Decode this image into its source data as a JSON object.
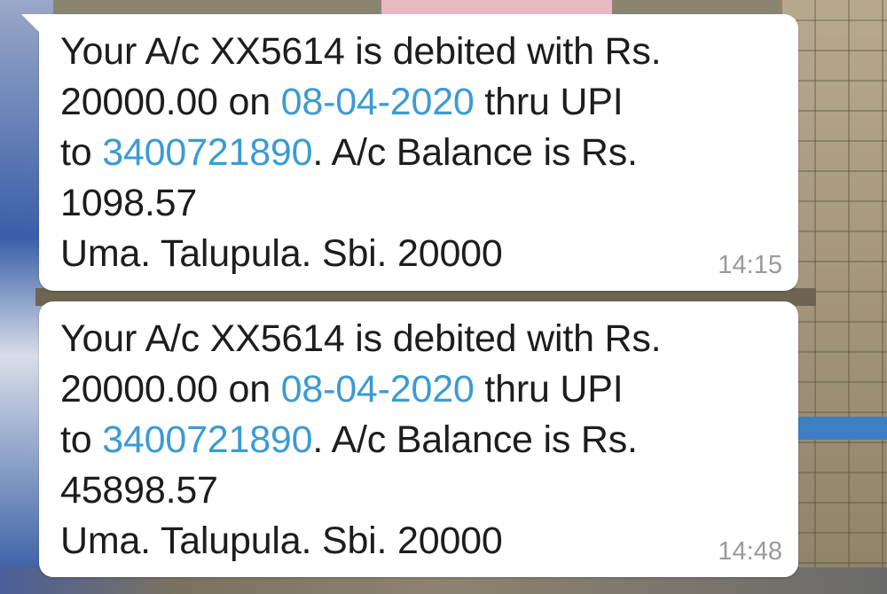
{
  "messages": [
    {
      "line1": "Your A/c XX5614 is debited with Rs.",
      "l2_prefix": "20000.00 on ",
      "date": "08-04-2020",
      "l2_suffix": " thru UPI",
      "l3_prefix": "to ",
      "account": "3400721890",
      "l3_suffix": ". A/c Balance is Rs.",
      "balance": "1098.57",
      "note": "Uma. Talupula. Sbi.  20000",
      "time": "14:15"
    },
    {
      "line1": "Your A/c XX5614 is debited with Rs.",
      "l2_prefix": "20000.00 on ",
      "date": "08-04-2020",
      "l2_suffix": " thru UPI",
      "l3_prefix": "to ",
      "account": "3400721890",
      "l3_suffix": ". A/c Balance is Rs.",
      "balance": "45898.57",
      "note": "Uma. Talupula. Sbi. 20000",
      "time": "14:48"
    }
  ],
  "colors": {
    "link": "#3b9bd3",
    "bubble": "#ffffff",
    "timestamp": "#9a9a9a"
  }
}
